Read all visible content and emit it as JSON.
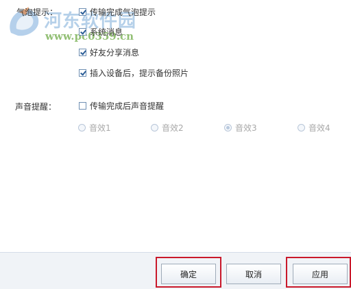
{
  "bubble": {
    "label": "气泡提示：",
    "options": [
      {
        "label": "传输完成气泡提示",
        "checked": true
      },
      {
        "label": "系统消息",
        "checked": true
      },
      {
        "label": "好友分享消息",
        "checked": true
      },
      {
        "label": "插入设备后，提示备份照片",
        "checked": true
      }
    ]
  },
  "sound": {
    "label": "声音提醒：",
    "checkbox_label": "传输完成后声音提醒",
    "checked": false,
    "options": [
      "音效1",
      "音效2",
      "音效3",
      "音效4"
    ],
    "selected": "音效3"
  },
  "buttons": {
    "ok": "确定",
    "cancel": "取消",
    "apply": "应用"
  },
  "watermark": {
    "title": "河东软件园",
    "url": "www.pc0359.cn"
  },
  "colors": {
    "highlight": "#c9182a",
    "checkmark": "#2a5d97"
  }
}
